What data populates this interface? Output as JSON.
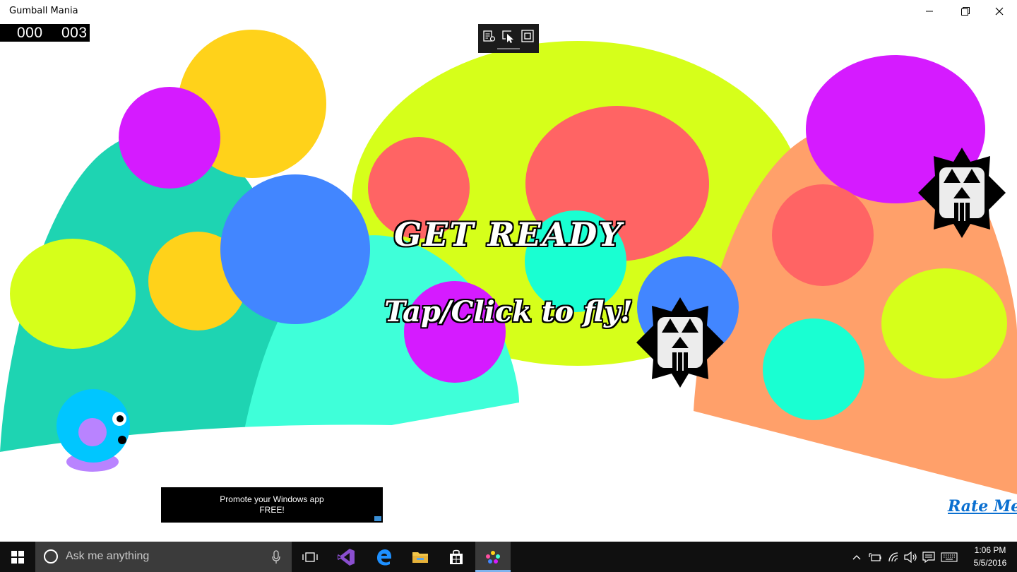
{
  "window": {
    "title": "Gumball Mania",
    "controls": [
      "minimize",
      "restore",
      "close"
    ]
  },
  "score": {
    "left": "000",
    "right": "003"
  },
  "debug_toolbar": {
    "icons": [
      "live-visual-tree-icon",
      "select-element-icon",
      "display-layout-adorners-icon"
    ]
  },
  "game": {
    "get_ready": "GET READY",
    "instruction": "Tap/Click to fly!",
    "rate_me": "Rate Me",
    "enemies": 2,
    "player_character": "blue-gumball"
  },
  "ad_banner": {
    "line1": "Promote your Windows app",
    "line2": "FREE!"
  },
  "taskbar": {
    "search_placeholder": "Ask me anything",
    "pinned_apps": [
      "task-view",
      "visual-studio",
      "edge",
      "file-explorer",
      "store",
      "gumball-mania"
    ],
    "active_app": "gumball-mania",
    "time": "1:06 PM",
    "date": "5/5/2016"
  },
  "colors": {
    "teal_hill": "#1ed4b2",
    "cyan_hill": "#3fffd9",
    "lime_hill": "#d6ff1a",
    "orange_hill": "#ffa06a",
    "yellow": "#ffd21a",
    "purple": "#d51bff",
    "blue": "#4286ff",
    "red": "#ff6464",
    "aqua": "#19ffd2",
    "player": "#00c6ff",
    "rate_me": "#0a6fd0"
  }
}
